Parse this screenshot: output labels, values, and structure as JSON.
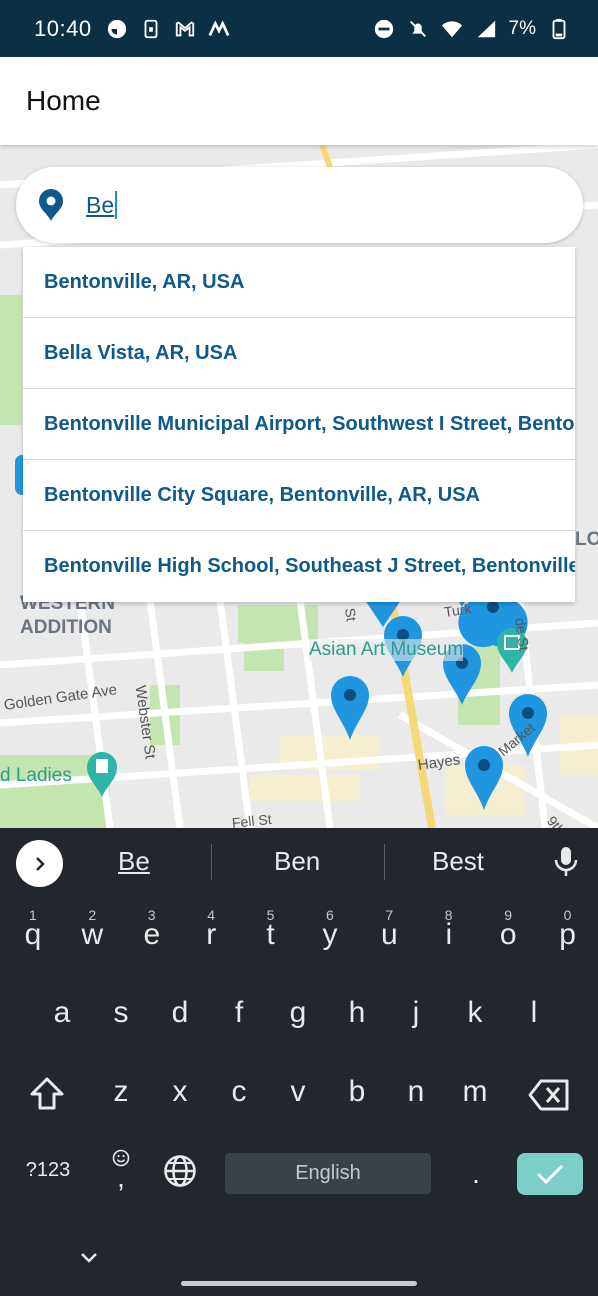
{
  "status_bar": {
    "time": "10:40",
    "battery": "7%",
    "icons": [
      "stopwatch-icon",
      "sim-icon",
      "gmail-icon",
      "m-app-icon",
      "do-not-disturb-icon",
      "mute-icon",
      "wifi-icon",
      "signal-icon",
      "battery-icon"
    ]
  },
  "app_bar": {
    "title": "Home"
  },
  "search": {
    "value": "Be",
    "icon": "location-pin-icon"
  },
  "suggestions": [
    "Bentonville, AR, USA",
    "Bella Vista, AR, USA",
    "Bentonville Municipal Airport, Southwest I Street, Bentonville, AR, USA",
    "Bentonville City Square, Bentonville, AR, USA",
    "Bentonville High School, Southeast J Street, Bentonville, AR, USA"
  ],
  "map": {
    "labels": {
      "western": "WESTERN",
      "addition": "ADDITION",
      "golden_gate": "Golden Gate Ave",
      "webster": "Webster St",
      "asian_art": "Asian Art Museum",
      "ladies": "d Ladies",
      "hayes": "Hayes",
      "market": "Market",
      "turk": "Turk",
      "fell": "Fell St",
      "ninth": "9th",
      "st": "St",
      "lo": "LO",
      "de_st": "de St"
    },
    "colors": {
      "pin": "#2196e0",
      "pin_dark": "#0b4e82",
      "park": "#c5e5b0",
      "highway": "#f6d977"
    }
  },
  "keyboard": {
    "suggestions": [
      "Be",
      "Ben",
      "Best"
    ],
    "row1": [
      "q",
      "w",
      "e",
      "r",
      "t",
      "y",
      "u",
      "i",
      "o",
      "p"
    ],
    "row1_hints": [
      "1",
      "2",
      "3",
      "4",
      "5",
      "6",
      "7",
      "8",
      "9",
      "0"
    ],
    "row2": [
      "a",
      "s",
      "d",
      "f",
      "g",
      "h",
      "j",
      "k",
      "l"
    ],
    "row3": [
      "z",
      "x",
      "c",
      "v",
      "b",
      "n",
      "m"
    ],
    "symbols_label": "?123",
    "comma": ",",
    "period": ".",
    "space_label": "English",
    "accent": "#7ccfc7"
  }
}
